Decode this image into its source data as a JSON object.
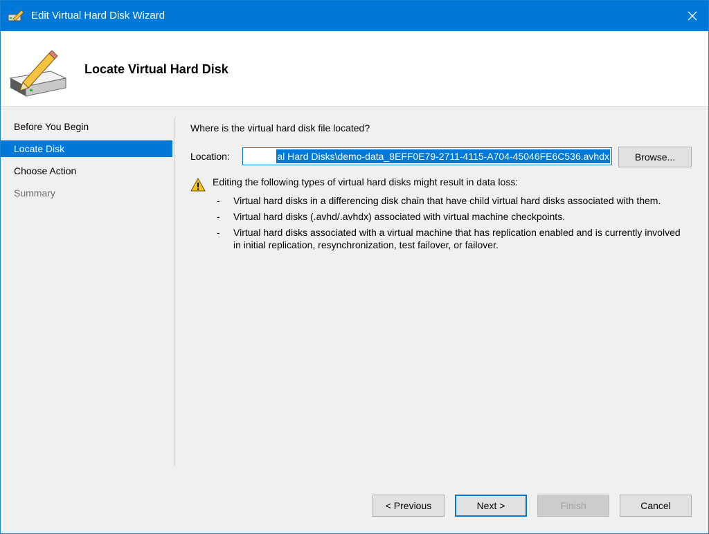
{
  "window": {
    "title": "Edit Virtual Hard Disk Wizard"
  },
  "header": {
    "title": "Locate Virtual Hard Disk"
  },
  "nav": {
    "items": [
      {
        "label": "Before You Begin",
        "state": "normal"
      },
      {
        "label": "Locate Disk",
        "state": "selected"
      },
      {
        "label": "Choose Action",
        "state": "normal"
      },
      {
        "label": "Summary",
        "state": "disabled"
      }
    ]
  },
  "content": {
    "question": "Where is the virtual hard disk file located?",
    "location_label": "Location:",
    "location_value": "al Hard Disks\\demo-data_8EFF0E79-2711-4115-A704-45046FE6C536.avhdx",
    "browse_label": "Browse...",
    "warning_text": "Editing the following types of virtual hard disks might result in data loss:",
    "warning_items": [
      "Virtual hard disks in a differencing disk chain that have child virtual hard disks associated with them.",
      "Virtual hard disks (.avhd/.avhdx) associated with virtual machine checkpoints.",
      "Virtual hard disks associated with a virtual machine that has replication enabled and is currently involved in initial replication, resynchronization, test failover, or failover."
    ]
  },
  "footer": {
    "previous_label": "< Previous",
    "next_label": "Next >",
    "finish_label": "Finish",
    "cancel_label": "Cancel"
  },
  "colors": {
    "accent": "#0078d7",
    "warning": "#f2c31b"
  },
  "icons": {
    "app": "disk-pencil-icon",
    "close": "close-icon",
    "warning": "warning-icon"
  }
}
